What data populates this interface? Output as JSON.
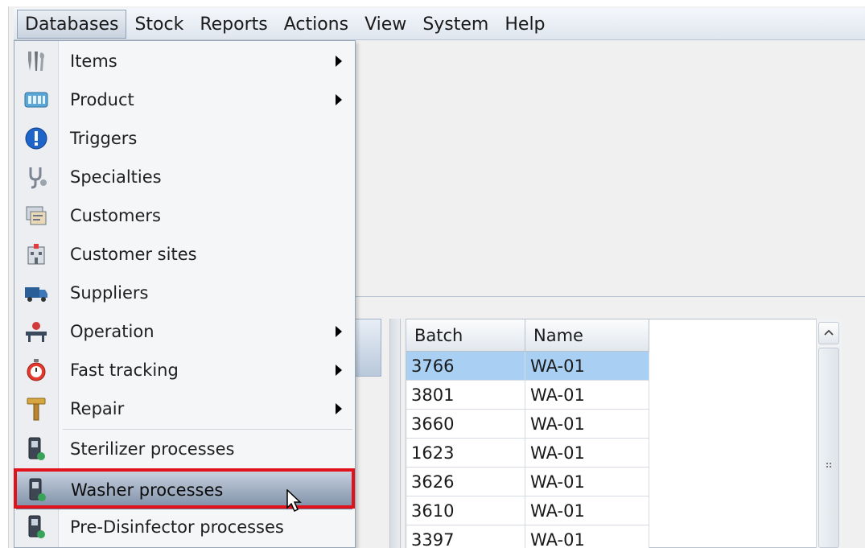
{
  "menubar": {
    "items": [
      {
        "label": "Databases",
        "active": true
      },
      {
        "label": "Stock"
      },
      {
        "label": "Reports"
      },
      {
        "label": "Actions"
      },
      {
        "label": "View"
      },
      {
        "label": "System"
      },
      {
        "label": "Help"
      }
    ]
  },
  "dropdown": {
    "items": [
      {
        "label": "Items",
        "icon": "tools-icon",
        "submenu": true
      },
      {
        "label": "Product",
        "icon": "tray-icon",
        "submenu": true
      },
      {
        "label": "Triggers",
        "icon": "alert-icon",
        "submenu": false
      },
      {
        "label": "Specialties",
        "icon": "stethoscope-icon",
        "submenu": false
      },
      {
        "label": "Customers",
        "icon": "customer-card-icon",
        "submenu": false
      },
      {
        "label": "Customer sites",
        "icon": "hospital-icon",
        "submenu": false
      },
      {
        "label": "Suppliers",
        "icon": "truck-icon",
        "submenu": false
      },
      {
        "label": "Operation",
        "icon": "operation-icon",
        "submenu": true
      },
      {
        "label": "Fast tracking",
        "icon": "stopwatch-icon",
        "submenu": true
      },
      {
        "label": "Repair",
        "icon": "hammer-icon",
        "submenu": true
      },
      {
        "label": "Sterilizer processes",
        "icon": "sterilizer-icon",
        "submenu": false
      },
      {
        "label": "Washer processes",
        "icon": "washer-icon",
        "submenu": false,
        "highlighted": true
      },
      {
        "label": "Pre-Disinfector processes",
        "icon": "pre-disinfector-icon",
        "submenu": false
      }
    ]
  },
  "grid": {
    "columns": [
      "Batch",
      "Name"
    ],
    "rows": [
      {
        "batch": "3766",
        "name": "WA-01",
        "selected": true
      },
      {
        "batch": "3801",
        "name": "WA-01"
      },
      {
        "batch": "3660",
        "name": "WA-01"
      },
      {
        "batch": "1623",
        "name": "WA-01"
      },
      {
        "batch": "3626",
        "name": "WA-01"
      },
      {
        "batch": "3610",
        "name": "WA-01"
      },
      {
        "batch": "3397",
        "name": "WA-01"
      }
    ]
  },
  "colors": {
    "highlight_box": "#e1121b",
    "selected_row": "#a9d0f3"
  }
}
